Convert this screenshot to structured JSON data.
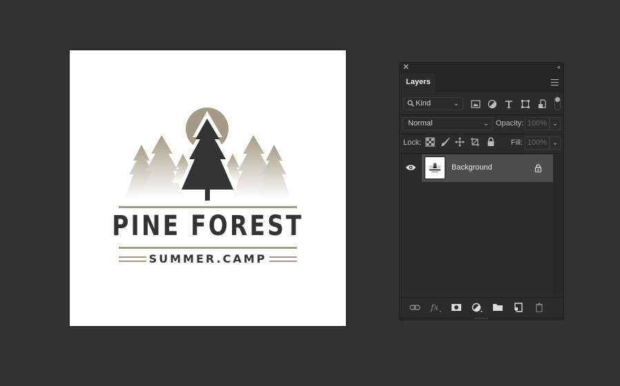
{
  "canvas": {
    "logo": {
      "title": "PINE FOREST",
      "subtitle": "SUMMER.CAMP",
      "colors": {
        "dark": "#333333",
        "tan": "#a39b86",
        "tan_light": "#d8d4c9"
      }
    }
  },
  "layers_panel": {
    "close_icon": "close-icon",
    "collapse_icon": "double-chevron-left-icon",
    "tab_label": "Layers",
    "menu_icon": "hamburger-menu-icon",
    "filter": {
      "kind_label": "Kind",
      "icons": [
        "image-filter-icon",
        "adjustment-filter-icon",
        "type-filter-icon",
        "shape-filter-icon",
        "smart-object-filter-icon"
      ],
      "toggle": "filter-toggle"
    },
    "blend_mode": "Normal",
    "opacity_label": "Opacity:",
    "opacity_value": "100%",
    "lock_label": "Lock:",
    "lock_icons": [
      "lock-transparent-pixels-icon",
      "lock-image-pixels-icon",
      "lock-position-icon",
      "lock-artboard-icon",
      "lock-all-icon"
    ],
    "fill_label": "Fill:",
    "fill_value": "100%",
    "layers": [
      {
        "name": "Background",
        "visible": true,
        "locked": true
      }
    ],
    "footer_icons": [
      "link-layers-icon",
      "fx-icon",
      "add-mask-icon",
      "adjustment-layer-icon",
      "new-group-icon",
      "new-layer-icon",
      "delete-icon"
    ]
  }
}
